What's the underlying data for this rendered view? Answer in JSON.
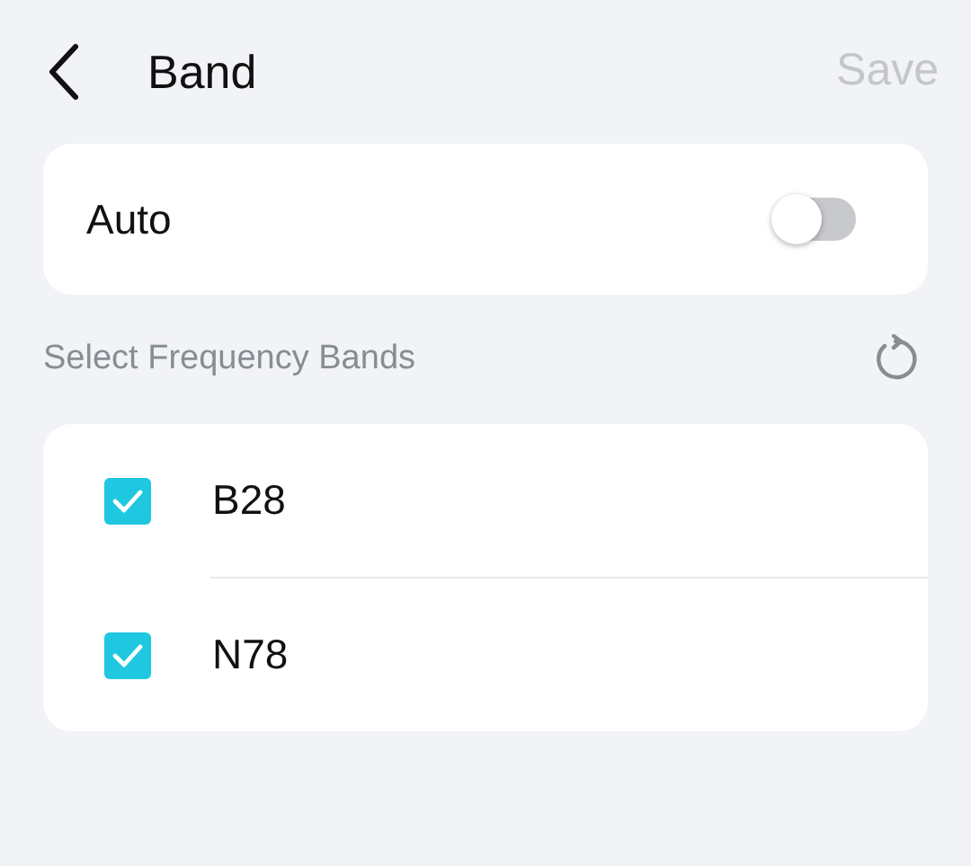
{
  "header": {
    "title": "Band",
    "save": {
      "label": "Save",
      "disabled": true
    }
  },
  "auto": {
    "label": "Auto",
    "on": false
  },
  "section": {
    "title": "Select Frequency Bands"
  },
  "bands": [
    {
      "label": "B28",
      "checked": true
    },
    {
      "label": "N78",
      "checked": true
    }
  ]
}
